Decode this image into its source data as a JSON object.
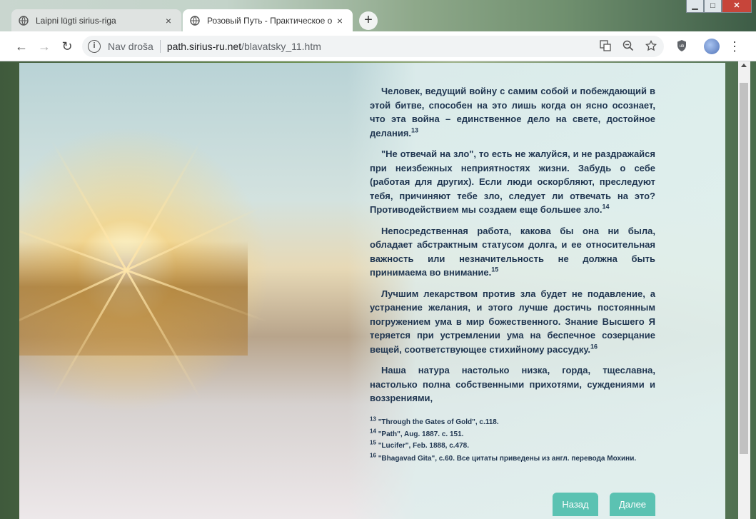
{
  "tabs": [
    {
      "title": "Laipni lūgti sirius-riga",
      "close": "×"
    },
    {
      "title": "Розовый Путь - Практическое о",
      "close": "×"
    }
  ],
  "new_tab": "+",
  "window_buttons": {
    "minimize": "▁",
    "maximize": "□",
    "close": "✕"
  },
  "nav": {
    "back": "←",
    "forward": "→",
    "reload": "↻"
  },
  "address": {
    "security_label": "Nav droša",
    "host": "path.sirius-ru.net",
    "path": "/blavatsky_11.htm"
  },
  "icons": [
    "translate-icon",
    "zoom-out-icon",
    "star-icon",
    "shield-extension-icon",
    "avatar",
    "kebab-menu-icon"
  ],
  "article": {
    "p1": "Человек, ведущий войну с самим собой и побеждающий в этой битве, способен на это лишь когда он ясно осознает, что эта война – единственное дело на свете, достойное делания.",
    "p1_sup": "13",
    "p2": "\"Не отвечай на зло\", то есть не жалуйся, и не раздражайся при неизбежных неприятностях жизни. Забудь о себе (работая для других). Если люди оскорбляют, преследуют тебя, причиняют тебе зло, следует ли отвечать на это? Противодействием мы создаем еще большее зло.",
    "p2_sup": "14",
    "p3": "Непосредственная работа, какова бы она ни была, обладает абстрактным статусом долга, и ее относительная важность или незначительность не должна быть принимаема во внимание.",
    "p3_sup": "15",
    "p4": "Лучшим лекарством против зла будет не подавление, а устранение желания, и этого лучше достичь постоянным погружением ума в мир божественного. Знание Высшего Я теряется при устремлении ума на беспечное созерцание вещей, соответствующее стихийному рассудку.",
    "p4_sup": "16",
    "p5": "Наша натура настолько низка, горда, тщеславна, настолько полна собственными прихотями, суждениями и воззрениями,"
  },
  "footnotes": [
    {
      "num": "13",
      "text": "\"Through the Gates of Gold\", с.118."
    },
    {
      "num": "14",
      "text": "\"Path\", Aug. 1887. с. 151."
    },
    {
      "num": "15",
      "text": "\"Lucifer\", Feb. 1888, с.478."
    },
    {
      "num": "16",
      "text": "\"Bhagavad Gita\", с.60. Все цитаты приведены из англ. перевода Мохини."
    }
  ],
  "buttons": {
    "back": "Назад",
    "next": "Далее"
  },
  "colors": {
    "text": "#1f3550",
    "button": "#5bc2b2"
  }
}
